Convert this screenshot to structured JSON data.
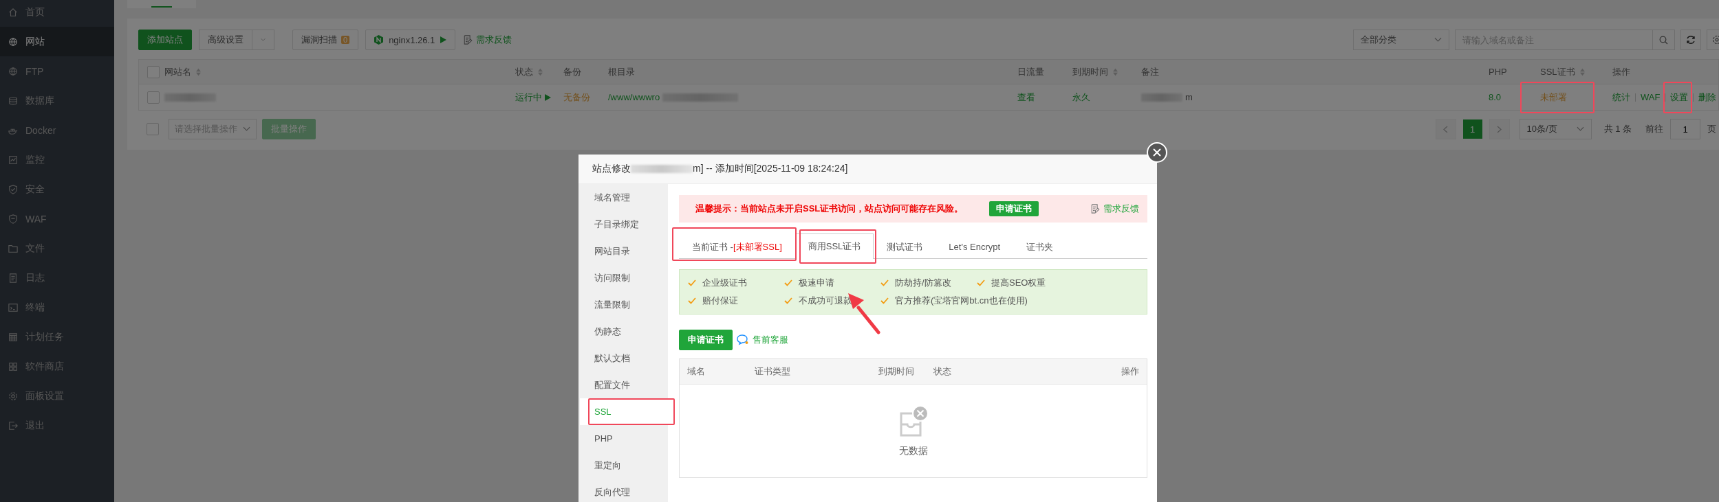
{
  "sidebar": {
    "items": [
      {
        "label": "首页",
        "selected": false
      },
      {
        "label": "网站",
        "selected": true
      },
      {
        "label": "FTP",
        "selected": false
      },
      {
        "label": "数据库",
        "selected": false
      },
      {
        "label": "Docker",
        "selected": false
      },
      {
        "label": "监控",
        "selected": false
      },
      {
        "label": "安全",
        "selected": false
      },
      {
        "label": "WAF",
        "selected": false
      },
      {
        "label": "文件",
        "selected": false
      },
      {
        "label": "日志",
        "selected": false
      },
      {
        "label": "终端",
        "selected": false
      },
      {
        "label": "计划任务",
        "selected": false
      },
      {
        "label": "软件商店",
        "selected": false
      },
      {
        "label": "面板设置",
        "selected": false
      },
      {
        "label": "退出",
        "selected": false
      }
    ]
  },
  "toolbar": {
    "add_button": "添加站点",
    "advanced_button": "高级设置",
    "scan_button": "漏洞扫描",
    "scan_count": "0",
    "nginx_button": "nginx1.26.1",
    "feedback_link": "需求反馈",
    "category_select": "全部分类",
    "search": {
      "placeholder": "请输入域名或备注"
    }
  },
  "table": {
    "columns": [
      {
        "label": "网站名",
        "sortable": true
      },
      {
        "label": "状态",
        "sortable": true
      },
      {
        "label": "备份",
        "sortable": false
      },
      {
        "label": "根目录",
        "sortable": false
      },
      {
        "label": "日流量",
        "sortable": false
      },
      {
        "label": "到期时间",
        "sortable": true
      },
      {
        "label": "备注",
        "sortable": false
      },
      {
        "label": "PHP",
        "sortable": false
      },
      {
        "label": "SSL证书",
        "sortable": true
      },
      {
        "label": "操作",
        "sortable": false
      }
    ],
    "select_all_checked": false,
    "rows": [
      {
        "checked": false,
        "status": "运行中",
        "backup": "无备份",
        "root": "/www/wwwro",
        "traffic": "查看",
        "expiry": "永久",
        "note": "m",
        "php": "8.0",
        "ssl": "未部署",
        "ssl_highlighted": true,
        "actions": [
          {
            "label": "统计",
            "highlighted": false
          },
          {
            "label": "WAF",
            "highlighted": false
          },
          {
            "label": "设置",
            "highlighted": true
          },
          {
            "label": "删除",
            "highlighted": false
          }
        ]
      }
    ]
  },
  "footer": {
    "select_all_checked": false,
    "batch_select": "请选择批量操作",
    "batch_button": "批量操作",
    "pages": [
      {
        "label": "1",
        "selected": true
      }
    ],
    "page_size": "10条/页",
    "total": "共 1 条",
    "goto_label": "前往",
    "goto_value": "1",
    "page_suffix": "页"
  },
  "modal": {
    "title_prefix": "站点修改",
    "title_suffix": "m] -- 添加时间[2025-11-09 18:24:24]",
    "nav": [
      {
        "label": "域名管理",
        "selected": false,
        "highlighted": false
      },
      {
        "label": "子目录绑定",
        "selected": false,
        "highlighted": false
      },
      {
        "label": "网站目录",
        "selected": false,
        "highlighted": false
      },
      {
        "label": "访问限制",
        "selected": false,
        "highlighted": false
      },
      {
        "label": "流量限制",
        "selected": false,
        "highlighted": false
      },
      {
        "label": "伪静态",
        "selected": false,
        "highlighted": false
      },
      {
        "label": "默认文档",
        "selected": false,
        "highlighted": false
      },
      {
        "label": "配置文件",
        "selected": false,
        "highlighted": false
      },
      {
        "label": "SSL",
        "selected": true,
        "highlighted": true
      },
      {
        "label": "PHP",
        "selected": false,
        "highlighted": false
      },
      {
        "label": "重定向",
        "selected": false,
        "highlighted": false
      },
      {
        "label": "反向代理",
        "selected": false,
        "highlighted": false
      }
    ],
    "alert": {
      "text": "温馨提示：当前站点未开启SSL证书访问，站点访问可能存在风险。",
      "button": "申请证书",
      "feedback": "需求反馈"
    },
    "tabs": [
      {
        "label": "当前证书 -",
        "status": "[未部署SSL]",
        "selected": false,
        "highlighted": true
      },
      {
        "label": "商用SSL证书",
        "selected": true,
        "highlighted": true
      },
      {
        "label": "测试证书",
        "selected": false,
        "highlighted": false
      },
      {
        "label": "Let's Encrypt",
        "selected": false,
        "highlighted": false
      },
      {
        "label": "证书夹",
        "selected": false,
        "highlighted": false
      }
    ],
    "features": [
      "企业级证书",
      "极速申请",
      "防劫持/防篡改",
      "提高SEO权重",
      "赔付保证",
      "不成功可退款",
      "官方推荐(宝塔官网bt.cn也在使用)"
    ],
    "apply_button": "申请证书",
    "support_link": "售前客服",
    "cert_table": {
      "columns": [
        "域名",
        "证书类型",
        "到期时间",
        "状态",
        "操作"
      ],
      "empty_text": "无数据"
    }
  }
}
